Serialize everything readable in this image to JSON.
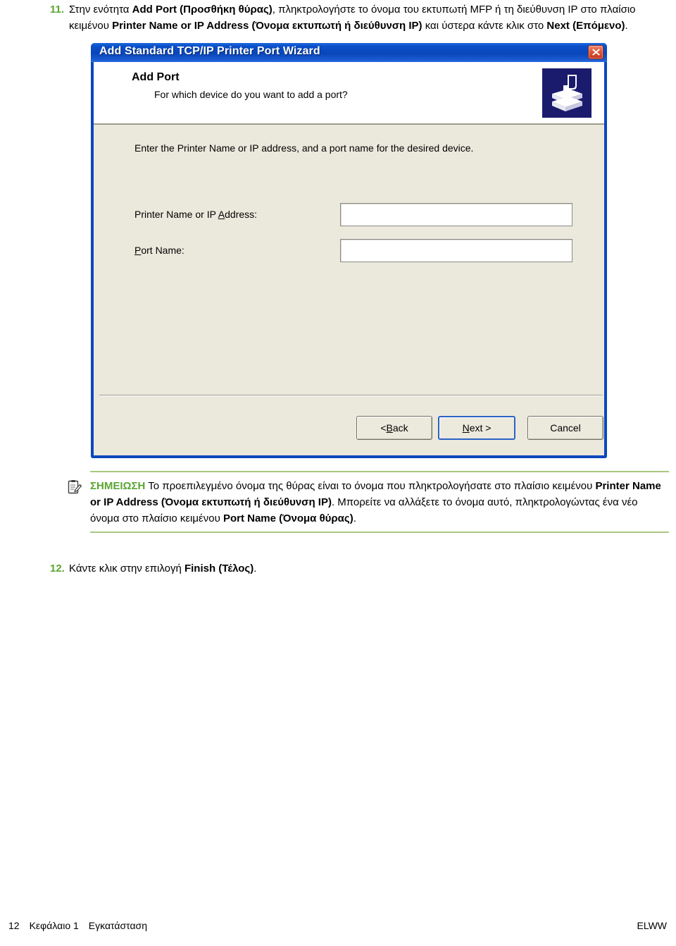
{
  "steps": [
    {
      "number": "11.",
      "segments": [
        {
          "text": "Στην ενότητα ",
          "bold": false
        },
        {
          "text": "Add Port (Προσθήκη θύρας)",
          "bold": true
        },
        {
          "text": ", πληκτρολογήστε το όνομα του εκτυπωτή MFP ή τη διεύθυνση IP στο πλαίσιο κειμένου ",
          "bold": false
        },
        {
          "text": "Printer Name or IP Address (Όνομα εκτυπωτή ή διεύθυνση IP)",
          "bold": true
        },
        {
          "text": " και ύστερα κάντε κλικ στο ",
          "bold": false
        },
        {
          "text": "Next (Επόμενο)",
          "bold": true
        },
        {
          "text": ".",
          "bold": false
        }
      ]
    },
    {
      "number": "12.",
      "segments": [
        {
          "text": "Κάντε κλικ στην επιλογή ",
          "bold": false
        },
        {
          "text": "Finish (Τέλος)",
          "bold": true
        },
        {
          "text": ".",
          "bold": false
        }
      ]
    }
  ],
  "dialog": {
    "title": "Add Standard TCP/IP Printer Port Wizard",
    "close_label": "close-icon",
    "header": {
      "heading": "Add Port",
      "subheading": "For which device do you want to add a port?",
      "icon_name": "printer-icon"
    },
    "body_instruction": "Enter the Printer Name or IP address, and a port name for the desired device.",
    "fields": [
      {
        "label_pre": "Printer Name or IP ",
        "label_accel": "A",
        "label_post": "ddress:",
        "value": "",
        "placeholder": ""
      },
      {
        "label_pre": "",
        "label_accel": "P",
        "label_post": "ort Name:",
        "value": "",
        "placeholder": ""
      }
    ],
    "buttons": [
      {
        "pre": "< ",
        "accel": "B",
        "post": "ack",
        "default": false
      },
      {
        "pre": "",
        "accel": "N",
        "post": "ext >",
        "default": true
      },
      {
        "pre": "",
        "accel": "",
        "post": "Cancel",
        "default": false
      }
    ]
  },
  "note": {
    "icon_name": "note-clipboard-icon",
    "label": "ΣΗΜΕΙΩΣΗ",
    "segments": [
      {
        "text": "  Το προεπιλεγμένο όνομα της θύρας είναι το όνομα που πληκτρολογήσατε στο πλαίσιο κειμένου ",
        "bold": false
      },
      {
        "text": "Printer Name or IP Address (Όνομα εκτυπωτή ή διεύθυνση IP)",
        "bold": true
      },
      {
        "text": ". Μπορείτε να αλλάξετε το όνομα αυτό, πληκτρολογώντας ένα νέο όνομα στο πλαίσιο κειμένου ",
        "bold": false
      },
      {
        "text": "Port Name (Όνομα θύρας)",
        "bold": true
      },
      {
        "text": ".",
        "bold": false
      }
    ]
  },
  "footer": {
    "page_number": "12",
    "chapter": "Κεφάλαιο 1",
    "section": "Εγκατάσταση",
    "right": "ELWW"
  },
  "colors": {
    "accent_green": "#5aa532",
    "note_rule_green": "#a9c77f",
    "titlebar_blue": "#0a46bb",
    "dialog_face": "#ebe9dc",
    "close_red": "#c23520",
    "printer_icon_navy": "#1b1b6e"
  }
}
